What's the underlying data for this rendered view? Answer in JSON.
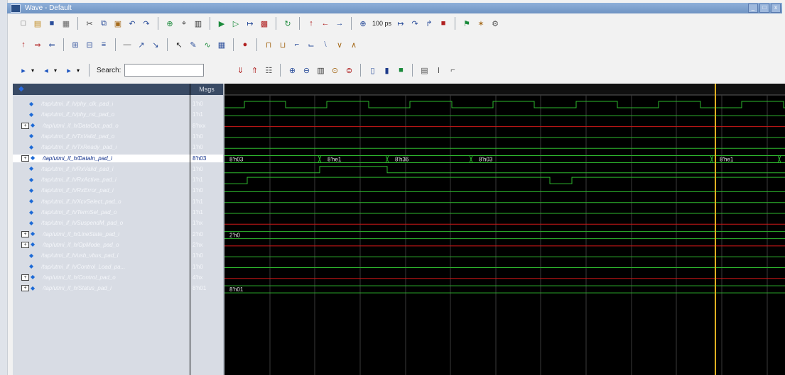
{
  "window": {
    "title": "Wave - Default",
    "buttons": [
      "_",
      "□",
      "x"
    ]
  },
  "toolbar1": {
    "icons": [
      "new-icon",
      "open-icon",
      "save-icon",
      "print-icon",
      "sep",
      "cut-icon",
      "copy-icon",
      "paste-icon",
      "undo-icon",
      "redo-icon",
      "sep",
      "add-icon",
      "find-icon",
      "zoom-full-icon",
      "sep",
      "run-icon",
      "continue-icon",
      "step-icon",
      "break-icon",
      "sep",
      "restart-icon",
      "sep",
      "up-arrow-icon",
      "left-arrow-icon",
      "right-arrow-icon",
      "sep",
      "zoom-in-icon"
    ],
    "zoom_value": "100 ps",
    "icons_after": [
      "step-icon",
      "step-over-icon",
      "step-out-icon",
      "stop-icon",
      "sep",
      "flag-icon",
      "bug-icon",
      "settings-icon"
    ]
  },
  "toolbar2": {
    "icons": [
      "cursor-up-icon",
      "cursor-next-icon",
      "cursor-prev-icon",
      "sep",
      "expand-icon",
      "collapse-icon",
      "group-icon",
      "sep",
      "divider-icon",
      "signal-add-icon",
      "signal-remove-icon",
      "sep",
      "select-icon",
      "edit-icon",
      "analog-icon",
      "table-icon",
      "sep",
      "record-icon",
      "sep",
      "wave-a-icon",
      "wave-b-icon",
      "wave-c-icon",
      "wave-d-icon",
      "wave-e-icon",
      "wave-f-icon",
      "wave-g-icon"
    ]
  },
  "toolbar3": {
    "search_label": "Search:",
    "search_value": "",
    "icons_after": [
      "search-next-icon",
      "search-prev-icon",
      "search-all-icon",
      "sep",
      "zoom-in-icon",
      "zoom-out-icon",
      "zoom-full-icon",
      "zoom-cursor-icon",
      "zoom-range-icon",
      "sep",
      "bookmark-icon",
      "fill-icon",
      "color-icon",
      "sep",
      "format-icon",
      "text-icon",
      "wave-style-icon"
    ]
  },
  "wave": {
    "value_header": "Msgs",
    "signals": [
      {
        "name": "/tap/utmi_if_h/phy_clk_pad_i",
        "value": "1'h0",
        "expander": "",
        "selected": false
      },
      {
        "name": "/tap/utmi_if_h/phy_rst_pad_o",
        "value": "1'h1",
        "expander": "",
        "selected": false
      },
      {
        "name": "/tap/utmi_if_h/DataOut_pad_o",
        "value": "8'hxx",
        "expander": "+",
        "selected": false
      },
      {
        "name": "/tap/utmi_if_h/TxValid_pad_o",
        "value": "1'h0",
        "expander": "",
        "selected": false
      },
      {
        "name": "/tap/utmi_if_h/TxReady_pad_i",
        "value": "1'h0",
        "expander": "",
        "selected": false
      },
      {
        "name": "/tap/utmi_if_h/DataIn_pad_i",
        "value": "8'h03",
        "expander": "+",
        "selected": true
      },
      {
        "name": "/tap/utmi_if_h/RxValid_pad_i",
        "value": "1'h0",
        "expander": "",
        "selected": false
      },
      {
        "name": "/tap/utmi_if_h/RxActive_pad_i",
        "value": "1'h1",
        "expander": "",
        "selected": false
      },
      {
        "name": "/tap/utmi_if_h/RxError_pad_i",
        "value": "1'h0",
        "expander": "",
        "selected": false
      },
      {
        "name": "/tap/utmi_if_h/XcvSelect_pad_o",
        "value": "1'h1",
        "expander": "",
        "selected": false
      },
      {
        "name": "/tap/utmi_if_h/TermSel_pad_o",
        "value": "1'h1",
        "expander": "",
        "selected": false
      },
      {
        "name": "/tap/utmi_if_h/SuspendM_pad_o",
        "value": "1'hx",
        "expander": "",
        "selected": false
      },
      {
        "name": "/tap/utmi_if_h/LineState_pad_i",
        "value": "2'h0",
        "expander": "+",
        "selected": false
      },
      {
        "name": "/tap/utmi_if_h/OpMode_pad_o",
        "value": "2'hx",
        "expander": "+",
        "selected": false
      },
      {
        "name": "/tap/utmi_if_h/usb_vbus_pad_i",
        "value": "1'h0",
        "expander": "",
        "selected": false
      },
      {
        "name": "/tap/utmi_if_h/Control_Load_pa...",
        "value": "1'h0",
        "expander": "",
        "selected": false
      },
      {
        "name": "/tap/utmi_if_h/Control_pad_o",
        "value": "4'hx",
        "expander": "+",
        "selected": false
      },
      {
        "name": "/tap/utmi_if_h/Status_pad_i",
        "value": "8'h01",
        "expander": "+",
        "selected": false
      }
    ],
    "bus_labels": [
      {
        "row": 5,
        "t": 0.005,
        "text": "8'h03"
      },
      {
        "row": 5,
        "t": 0.18,
        "text": "8'he1"
      },
      {
        "row": 5,
        "t": 0.3,
        "text": "8'h36"
      },
      {
        "row": 5,
        "t": 0.45,
        "text": "8'h03"
      },
      {
        "row": 5,
        "t": 0.88,
        "text": "8'he1"
      },
      {
        "row": 12,
        "t": 0.005,
        "text": "2'h0"
      },
      {
        "row": 17,
        "t": 0.005,
        "text": "8'h01"
      }
    ],
    "cursor_t": 0.876,
    "colors": {
      "signal": "#2eb82e",
      "undefined": "#d01818",
      "cursor": "#e0b020",
      "grid": "#3a3a3a",
      "background": "#000000"
    }
  }
}
